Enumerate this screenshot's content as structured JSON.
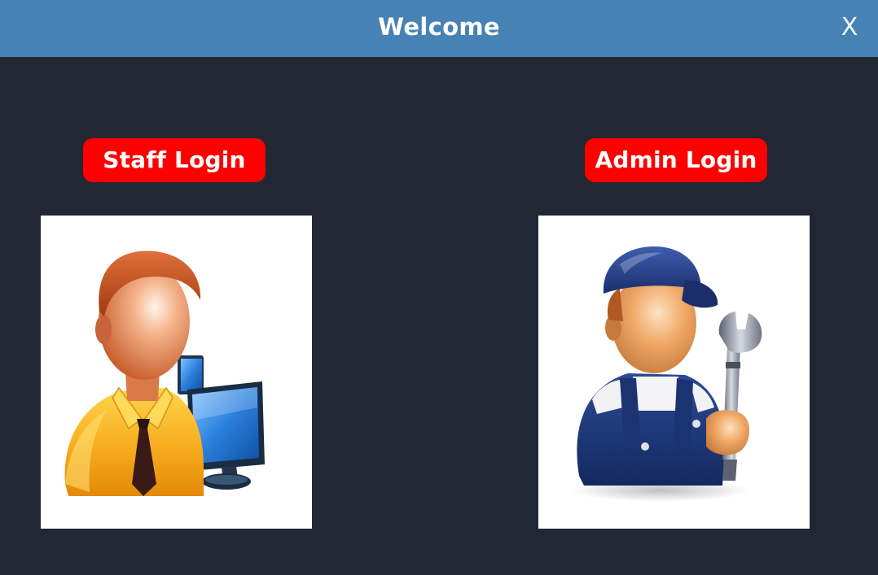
{
  "window": {
    "title": "Welcome",
    "close_label": "X",
    "titlebar_color": "#4682b4",
    "background_color": "#212833"
  },
  "staff": {
    "button_label": "Staff Login",
    "image_icon": "staff-user-computer-icon"
  },
  "admin": {
    "button_label": "Admin Login",
    "image_icon": "admin-mechanic-wrench-icon"
  },
  "colors": {
    "button": "#ff0000",
    "button_text": "#ffffff"
  }
}
